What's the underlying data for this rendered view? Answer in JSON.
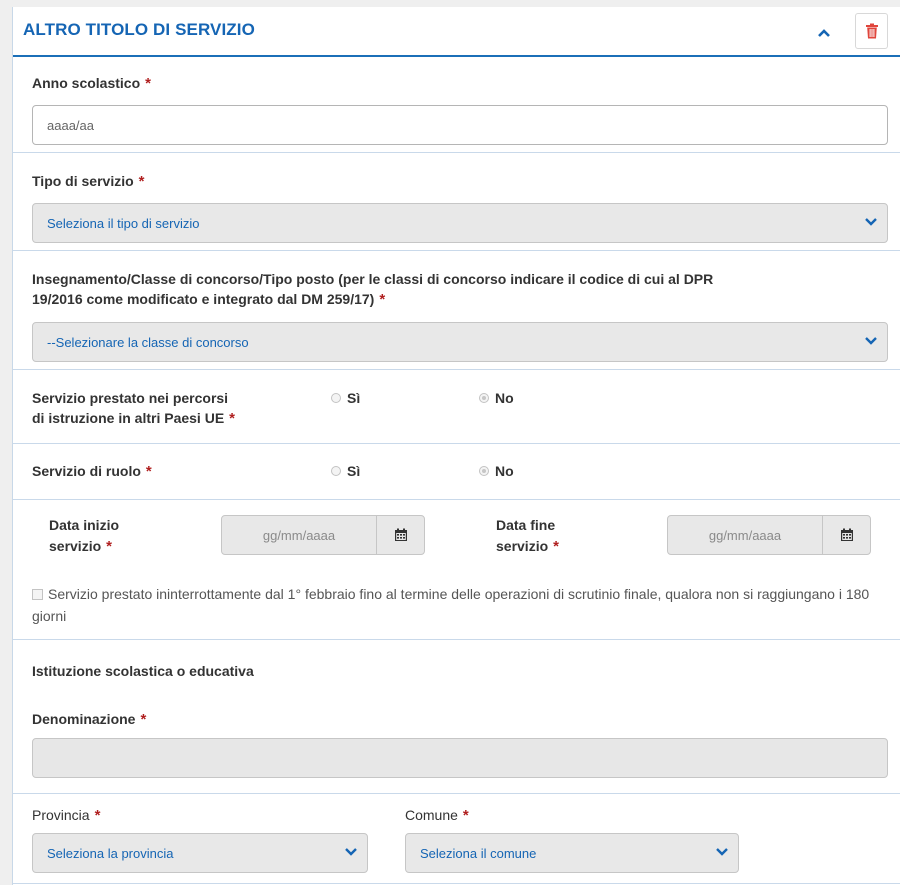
{
  "section": {
    "title": "ALTRO TITOLO DI SERVIZIO"
  },
  "anno": {
    "label": "Anno scolastico",
    "placeholder": "aaaa/aa"
  },
  "tipo_servizio": {
    "label": "Tipo di servizio",
    "selected": "Seleziona il tipo di servizio"
  },
  "insegnamento": {
    "label_line1": "Insegnamento/Classe di concorso/Tipo posto (per le classi di concorso indicare il codice di cui al DPR",
    "label_line2": "19/2016 come modificato e integrato dal DM 259/17)",
    "selected": "--Selezionare la classe di concorso"
  },
  "servizio_ue": {
    "label_line1": "Servizio prestato nei percorsi",
    "label_line2": "di istruzione in altri Paesi UE",
    "options": [
      "Sì",
      "No"
    ],
    "selected": "No"
  },
  "servizio_ruolo": {
    "label": "Servizio di ruolo",
    "options": [
      "Sì",
      "No"
    ],
    "selected": "No"
  },
  "data_inizio": {
    "label_line1": "Data inizio",
    "label_line2": "servizio",
    "placeholder": "gg/mm/aaaa"
  },
  "data_fine": {
    "label_line1": "Data fine",
    "label_line2": "servizio",
    "placeholder": "gg/mm/aaaa"
  },
  "ininterrotto": {
    "label": "Servizio prestato ininterrottamente dal 1° febbraio fino al termine delle operazioni di scrutinio finale, qualora non si raggiungano i 180 giorni",
    "checked": false
  },
  "istituzione": {
    "heading": "Istituzione scolastica o educativa",
    "denominazione_label": "Denominazione",
    "denominazione_value": ""
  },
  "provincia": {
    "label": "Provincia",
    "selected": "Seleziona la provincia"
  },
  "comune": {
    "label": "Comune",
    "selected": "Seleziona il comune"
  },
  "required_marker": "*",
  "colors": {
    "accent": "#1565b4",
    "required": "#b01f1f",
    "delete": "#e0453c"
  },
  "icons": {
    "collapse": "chevron-up-icon",
    "delete": "trash-icon",
    "dropdown": "chevron-down-icon",
    "calendar": "calendar-icon"
  }
}
